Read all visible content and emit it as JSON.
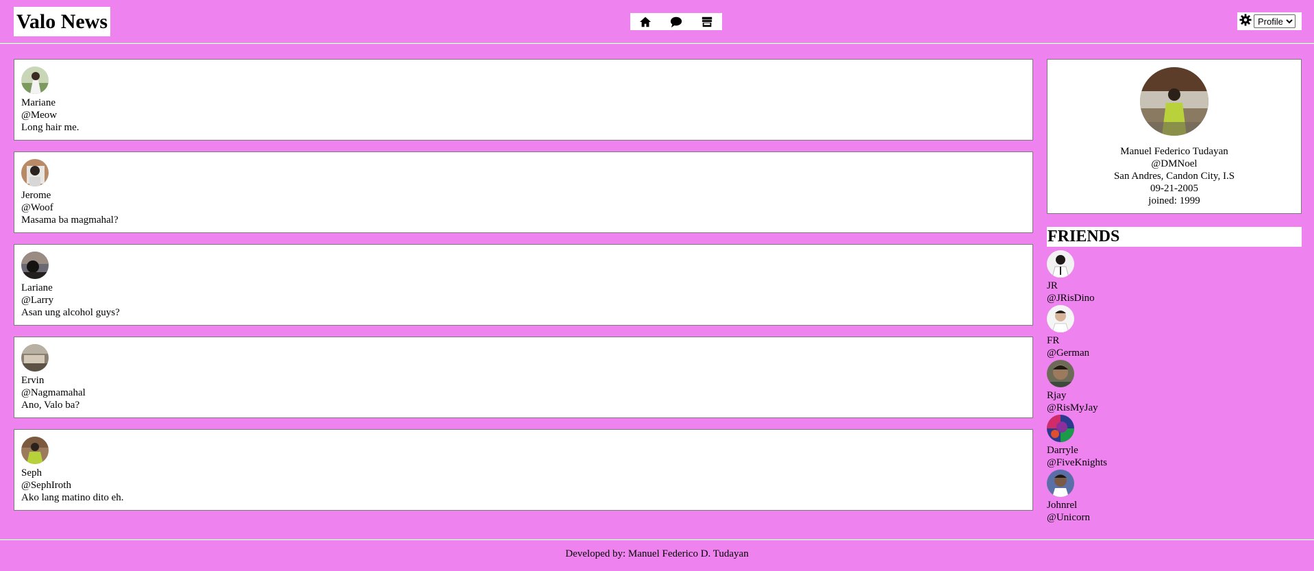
{
  "header": {
    "title": "Valo News",
    "nav": [
      {
        "name": "home-icon"
      },
      {
        "name": "comment-icon"
      },
      {
        "name": "store-icon"
      }
    ],
    "settings_icon": "gear-icon",
    "profile_select": {
      "selected": "Profile",
      "options": [
        "Profile"
      ]
    }
  },
  "colors": {
    "background": "#ee82ee",
    "card": "#ffffff",
    "border": "#7a7a7a"
  },
  "posts": [
    {
      "name": "Mariane",
      "handle": "@Meow",
      "text": "Long hair me."
    },
    {
      "name": "Jerome",
      "handle": "@Woof",
      "text": "Masama ba magmahal?"
    },
    {
      "name": "Lariane",
      "handle": "@Larry",
      "text": "Asan ung alcohol guys?"
    },
    {
      "name": "Ervin",
      "handle": "@Nagmamahal",
      "text": "Ano, Valo ba?"
    },
    {
      "name": "Seph",
      "handle": "@SephIroth",
      "text": "Ako lang matino dito eh."
    }
  ],
  "profile": {
    "name": "Manuel Federico Tudayan",
    "handle": "@DMNoel",
    "location": "San Andres, Candon City, I.S",
    "birthdate": "09-21-2005",
    "joined": "joined: 1999"
  },
  "friends": {
    "title": "FRIENDS",
    "items": [
      {
        "name": "JR",
        "handle": "@JRisDino"
      },
      {
        "name": "FR",
        "handle": "@German"
      },
      {
        "name": "Rjay",
        "handle": "@RisMyJay"
      },
      {
        "name": "Darryle",
        "handle": "@FiveKnights"
      },
      {
        "name": "Johnrel",
        "handle": "@Unicorn"
      }
    ]
  },
  "footer": {
    "text": "Developed by: Manuel Federico D. Tudayan"
  }
}
